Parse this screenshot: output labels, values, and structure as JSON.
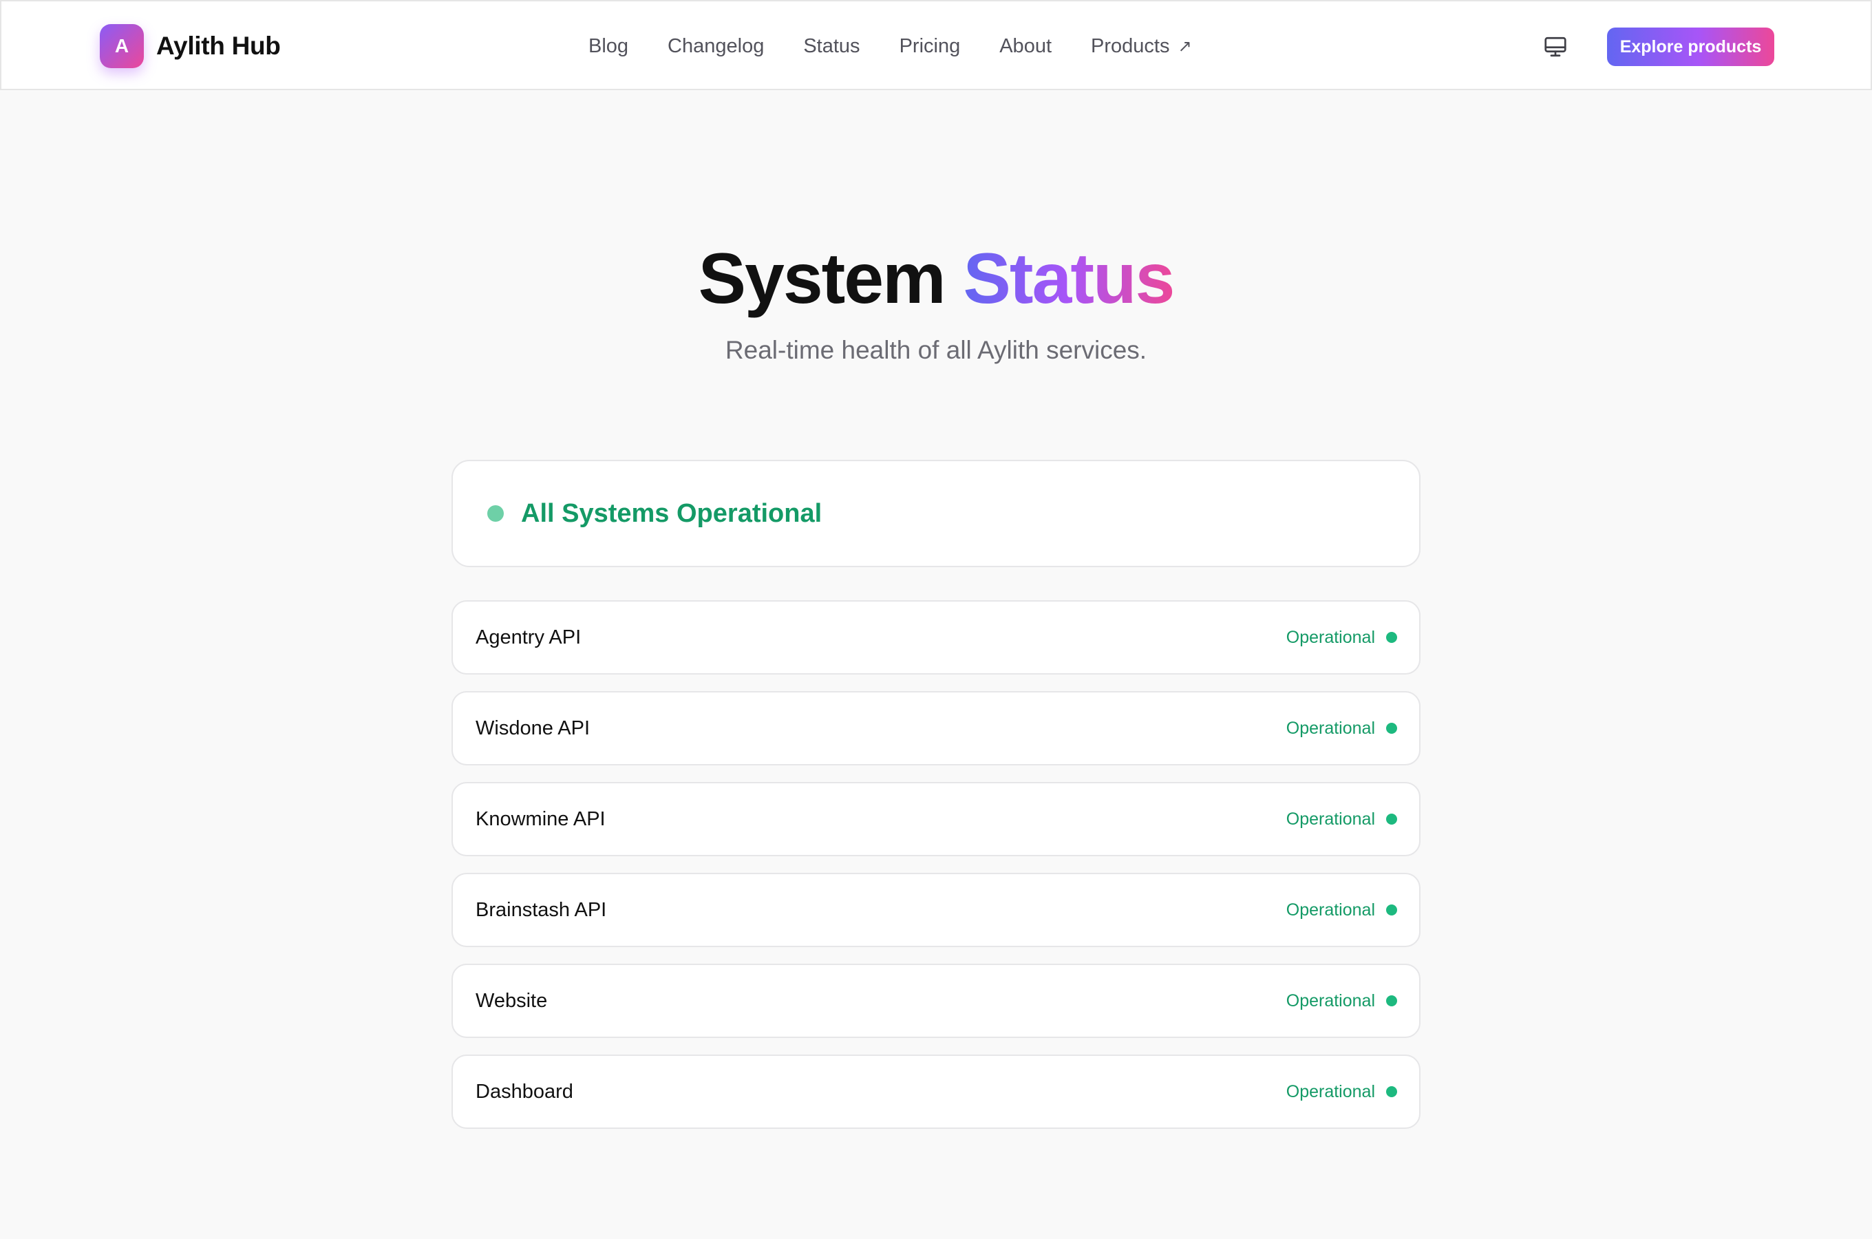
{
  "brand": {
    "logo_letter": "A",
    "name": "Aylith Hub"
  },
  "nav": {
    "items": [
      {
        "label": "Blog"
      },
      {
        "label": "Changelog"
      },
      {
        "label": "Status"
      },
      {
        "label": "Pricing"
      },
      {
        "label": "About"
      },
      {
        "label": "Products",
        "icon": "external-arrow-icon"
      }
    ],
    "external_arrow": "↗"
  },
  "header_actions": {
    "monitor_icon": "monitor-icon",
    "cta_label": "Explore products"
  },
  "hero": {
    "title_part1": "System",
    "title_part2": "Status",
    "subtitle": "Real-time health of all Aylith services."
  },
  "summary": {
    "text": "All Systems Operational",
    "status_color": "#6ed0a7"
  },
  "services": [
    {
      "name": "Agentry API",
      "status": "Operational"
    },
    {
      "name": "Wisdone API",
      "status": "Operational"
    },
    {
      "name": "Knowmine API",
      "status": "Operational"
    },
    {
      "name": "Brainstash API",
      "status": "Operational"
    },
    {
      "name": "Website",
      "status": "Operational"
    },
    {
      "name": "Dashboard",
      "status": "Operational"
    }
  ],
  "colors": {
    "accent_start": "#6366f1",
    "accent_mid": "#a855f7",
    "accent_end": "#ec4899",
    "operational": "#149a66",
    "operational_dot": "#1db97f"
  }
}
